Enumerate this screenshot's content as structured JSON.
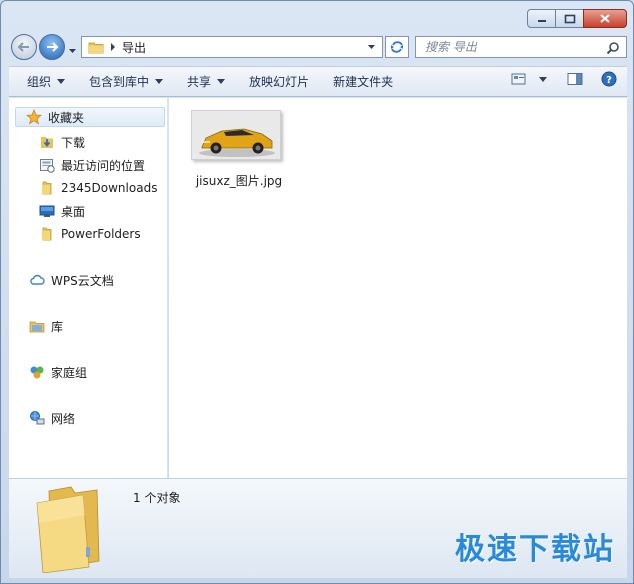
{
  "window": {
    "title": "导出"
  },
  "address": {
    "path": "导出"
  },
  "search": {
    "placeholder": "搜索 导出"
  },
  "toolbar": {
    "organize": "组织",
    "include_in_library": "包含到库中",
    "share": "共享",
    "slideshow": "放映幻灯片",
    "new_folder": "新建文件夹"
  },
  "sidebar": {
    "favorites": "收藏夹",
    "downloads": "下载",
    "recent": "最近访问的位置",
    "downloads2345": "2345Downloads",
    "desktop": "桌面",
    "powerfolders": "PowerFolders",
    "wps": "WPS云文档",
    "library": "库",
    "homegroup": "家庭组",
    "network": "网络"
  },
  "files": [
    {
      "name": "jisuxz_图片.jpg",
      "icon": "image-thumbnail"
    }
  ],
  "details": {
    "count": "1 个对象"
  },
  "watermark": {
    "text": "极速下载站"
  },
  "colors": {
    "accent": "#2a8ad8",
    "selection": "#dfeaf7",
    "close": "#c7402b"
  }
}
